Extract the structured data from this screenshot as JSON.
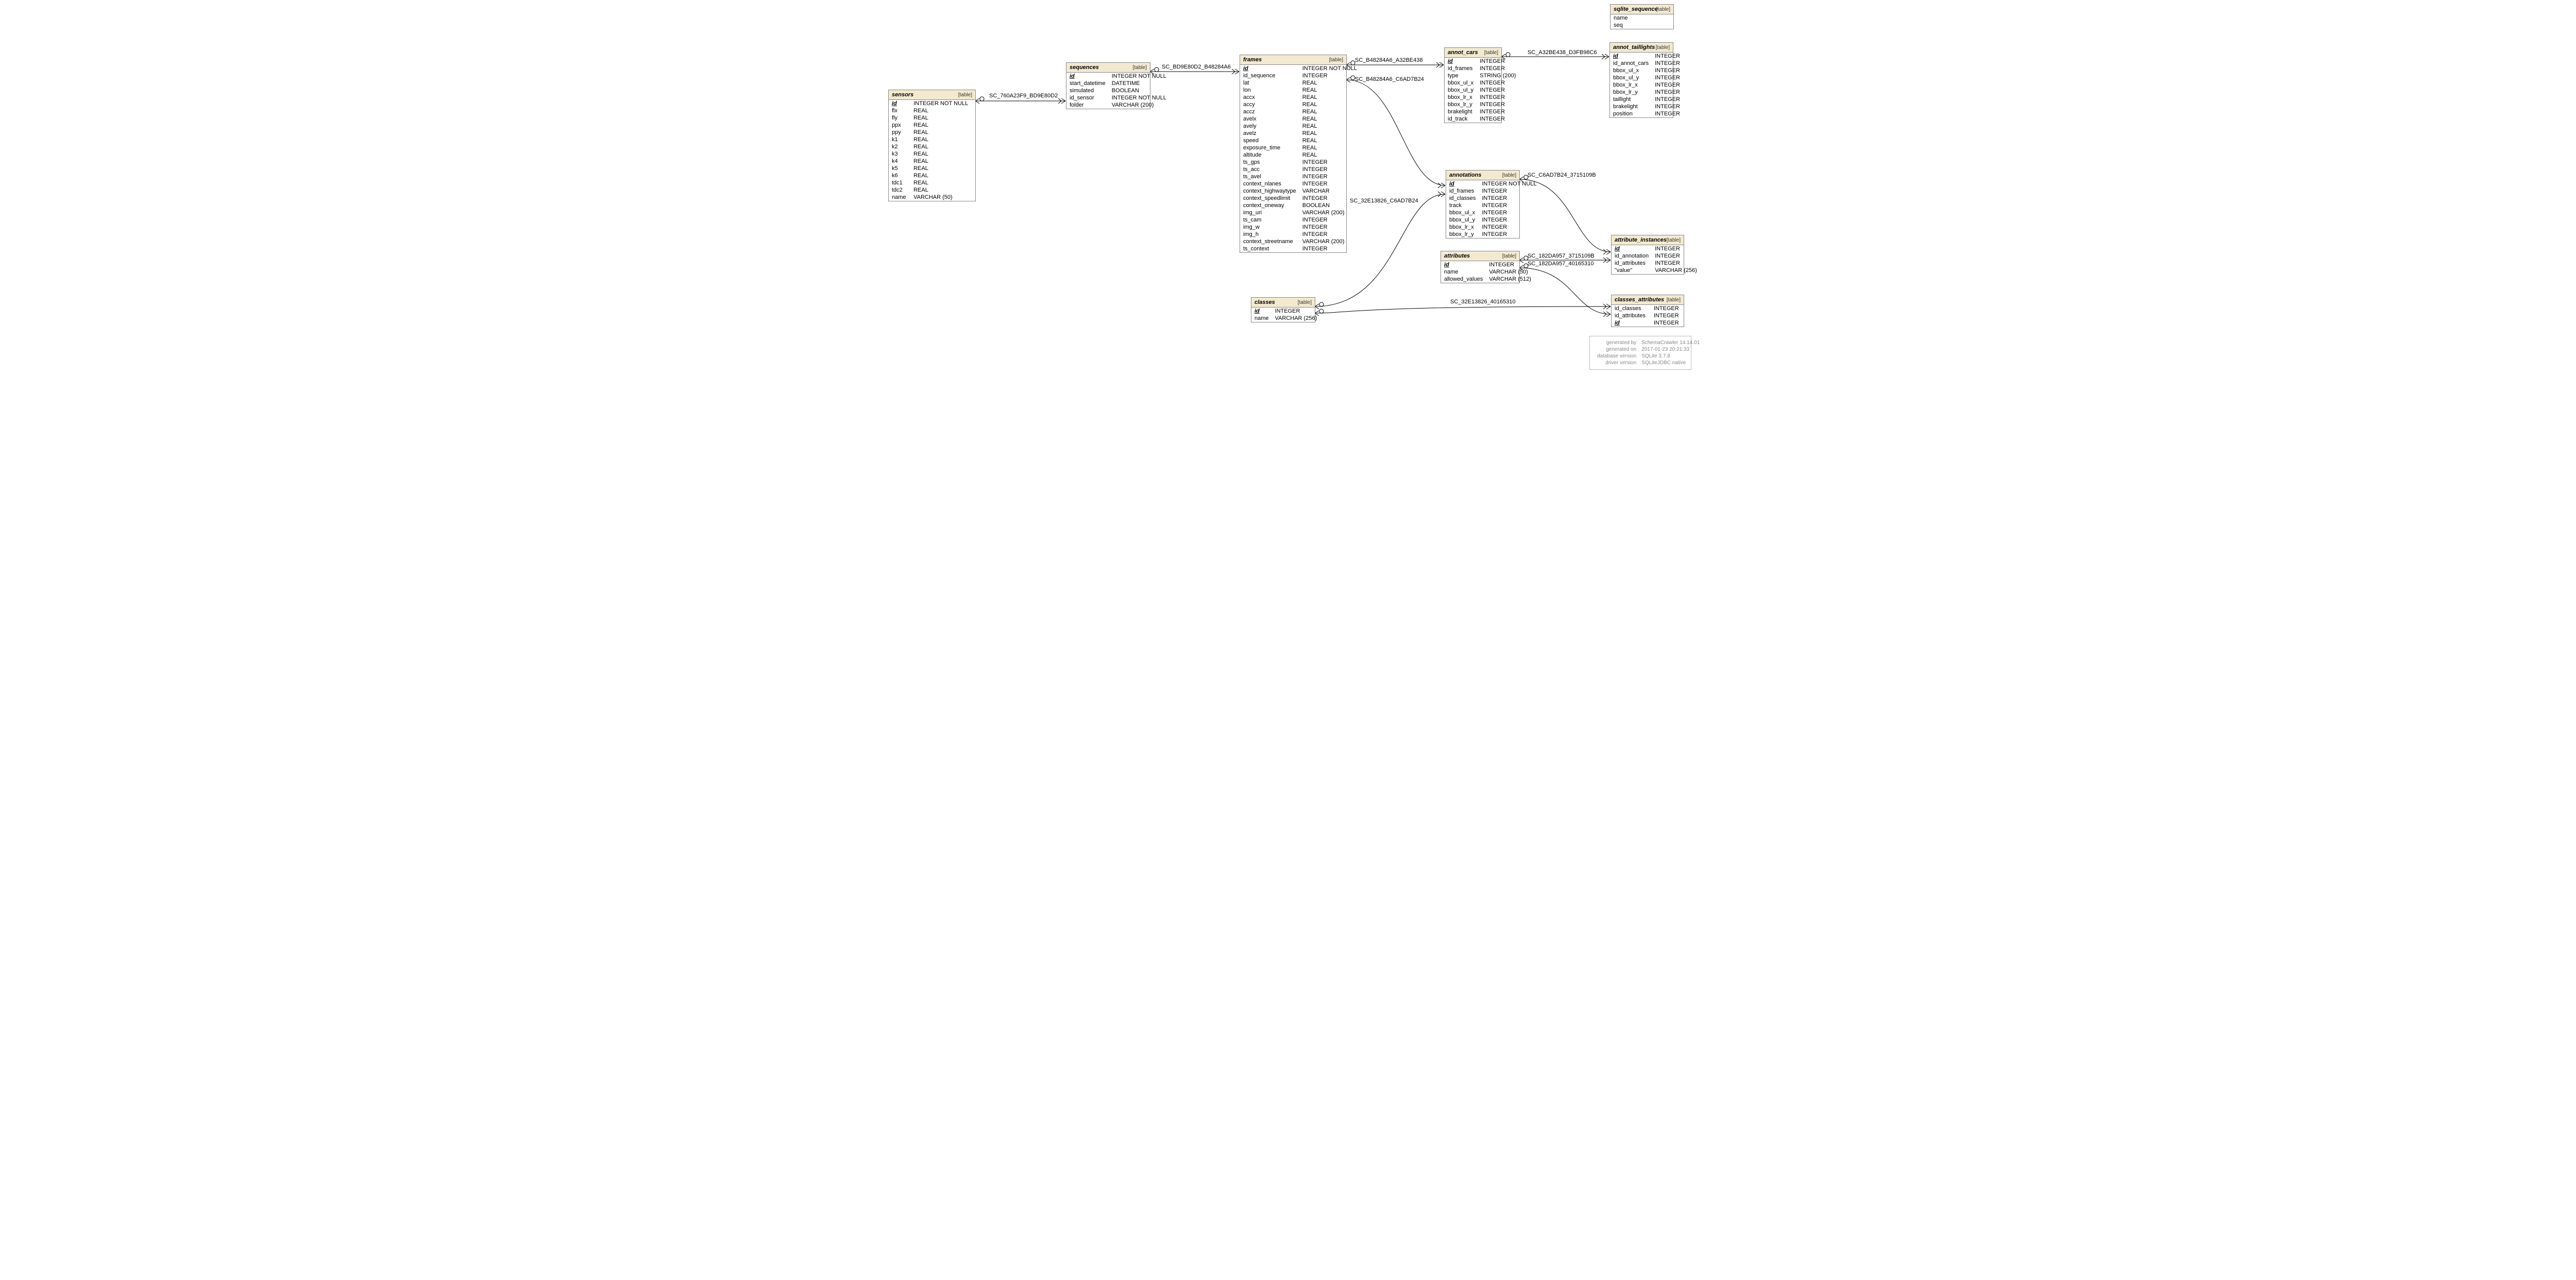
{
  "tag_label": "[table]",
  "tables": {
    "sensors": {
      "title": "sensors",
      "cols": [
        [
          "id",
          "INTEGER NOT NULL",
          true
        ],
        [
          "flx",
          "REAL"
        ],
        [
          "fly",
          "REAL"
        ],
        [
          "ppx",
          "REAL"
        ],
        [
          "ppy",
          "REAL"
        ],
        [
          "k1",
          "REAL"
        ],
        [
          "k2",
          "REAL"
        ],
        [
          "k3",
          "REAL"
        ],
        [
          "k4",
          "REAL"
        ],
        [
          "k5",
          "REAL"
        ],
        [
          "k6",
          "REAL"
        ],
        [
          "tdc1",
          "REAL"
        ],
        [
          "tdc2",
          "REAL"
        ],
        [
          "name",
          "VARCHAR (50)"
        ]
      ]
    },
    "sequences": {
      "title": "sequences",
      "cols": [
        [
          "id",
          "INTEGER NOT NULL",
          true
        ],
        [
          "start_datetime",
          "DATETIME"
        ],
        [
          "simulated",
          "BOOLEAN"
        ],
        [
          "id_sensor",
          "INTEGER NOT NULL"
        ],
        [
          "folder",
          "VARCHAR (200)"
        ]
      ]
    },
    "frames": {
      "title": "frames",
      "cols": [
        [
          "id",
          "INTEGER NOT NULL",
          true
        ],
        [
          "id_sequence",
          "INTEGER"
        ],
        [
          "lat",
          "REAL"
        ],
        [
          "lon",
          "REAL"
        ],
        [
          "accx",
          "REAL"
        ],
        [
          "accy",
          "REAL"
        ],
        [
          "accz",
          "REAL"
        ],
        [
          "avelx",
          "REAL"
        ],
        [
          "avely",
          "REAL"
        ],
        [
          "avelz",
          "REAL"
        ],
        [
          "speed",
          "REAL"
        ],
        [
          "exposure_time",
          "REAL"
        ],
        [
          "altitude",
          "REAL"
        ],
        [
          "ts_gps",
          "INTEGER"
        ],
        [
          "ts_acc",
          "INTEGER"
        ],
        [
          "ts_avel",
          "INTEGER"
        ],
        [
          "context_nlanes",
          "INTEGER"
        ],
        [
          "context_highwaytype",
          "VARCHAR"
        ],
        [
          "context_speedlimit",
          "INTEGER"
        ],
        [
          "context_oneway",
          "BOOLEAN"
        ],
        [
          "img_uri",
          "VARCHAR (200)"
        ],
        [
          "ts_cam",
          "INTEGER"
        ],
        [
          "img_w",
          "INTEGER"
        ],
        [
          "img_h",
          "INTEGER"
        ],
        [
          "context_streetname",
          "VARCHAR (200)"
        ],
        [
          "ts_context",
          "INTEGER"
        ]
      ]
    },
    "annot_cars": {
      "title": "annot_cars",
      "cols": [
        [
          "id",
          "INTEGER",
          true
        ],
        [
          "id_frames",
          "INTEGER"
        ],
        [
          "type",
          "STRING (200)"
        ],
        [
          "bbox_ul_x",
          "INTEGER"
        ],
        [
          "bbox_ul_y",
          "INTEGER"
        ],
        [
          "bbox_lr_x",
          "INTEGER"
        ],
        [
          "bbox_lr_y",
          "INTEGER"
        ],
        [
          "brakelight",
          "INTEGER"
        ],
        [
          "id_track",
          "INTEGER"
        ]
      ]
    },
    "annot_taillights": {
      "title": "annot_taillights",
      "cols": [
        [
          "id",
          "INTEGER",
          true
        ],
        [
          "id_annot_cars",
          "INTEGER"
        ],
        [
          "bbox_ul_x",
          "INTEGER"
        ],
        [
          "bbox_ul_y",
          "INTEGER"
        ],
        [
          "bbox_lr_x",
          "INTEGER"
        ],
        [
          "bbox_lr_y",
          "INTEGER"
        ],
        [
          "taillight",
          "INTEGER"
        ],
        [
          "brakelight",
          "INTEGER"
        ],
        [
          "position",
          "INTEGER"
        ]
      ]
    },
    "sqlite_sequence": {
      "title": "sqlite_sequence",
      "cols": [
        [
          "name",
          ""
        ],
        [
          "seq",
          ""
        ]
      ]
    },
    "annotations": {
      "title": "annotations",
      "cols": [
        [
          "id",
          "INTEGER NOT NULL",
          true
        ],
        [
          "id_frames",
          "INTEGER"
        ],
        [
          "id_classes",
          "INTEGER"
        ],
        [
          "track",
          "INTEGER"
        ],
        [
          "bbox_ul_x",
          "INTEGER"
        ],
        [
          "bbox_ul_y",
          "INTEGER"
        ],
        [
          "bbox_lr_x",
          "INTEGER"
        ],
        [
          "bbox_lr_y",
          "INTEGER"
        ]
      ]
    },
    "attributes": {
      "title": "attributes",
      "cols": [
        [
          "id",
          "INTEGER",
          true
        ],
        [
          "name",
          "VARCHAR (50)"
        ],
        [
          "allowed_values",
          "VARCHAR (512)"
        ]
      ]
    },
    "attribute_instances": {
      "title": "attribute_instances",
      "cols": [
        [
          "id",
          "INTEGER",
          true
        ],
        [
          "id_annotation",
          "INTEGER"
        ],
        [
          "id_attributes",
          "INTEGER"
        ],
        [
          "\"value\"",
          "VARCHAR (256)"
        ]
      ]
    },
    "classes": {
      "title": "classes",
      "cols": [
        [
          "id",
          "INTEGER",
          true
        ],
        [
          "name",
          "VARCHAR (256)"
        ]
      ]
    },
    "classes_attributes": {
      "title": "classes_attributes",
      "cols": [
        [
          "id_classes",
          "INTEGER"
        ],
        [
          "id_attributes",
          "INTEGER"
        ],
        [
          "id",
          "INTEGER",
          true
        ]
      ]
    }
  },
  "relations": {
    "r1": "SC_760A23F9_BD9E80D2",
    "r2": "SC_BD9E80D2_B48284A6",
    "r3": "SC_B48284A6_A32BE438",
    "r4": "SC_B48284A6_C6AD7B24",
    "r5": "SC_A32BE438_D3FB98C6",
    "r6": "SC_C6AD7B24_3715109B",
    "r7": "SC_32E13826_C6AD7B24",
    "r8": "SC_182DA957_3715109B",
    "r9": "SC_182DA957_40165310",
    "r10": "SC_32E13826_40165310"
  },
  "info": [
    [
      "generated by",
      "SchemaCrawler 14.14.01"
    ],
    [
      "generated on",
      "2017-01-23 20:21:33"
    ],
    [
      "database version",
      "SQLite 3.7.8"
    ],
    [
      "driver version",
      "SQLiteJDBC native"
    ]
  ]
}
